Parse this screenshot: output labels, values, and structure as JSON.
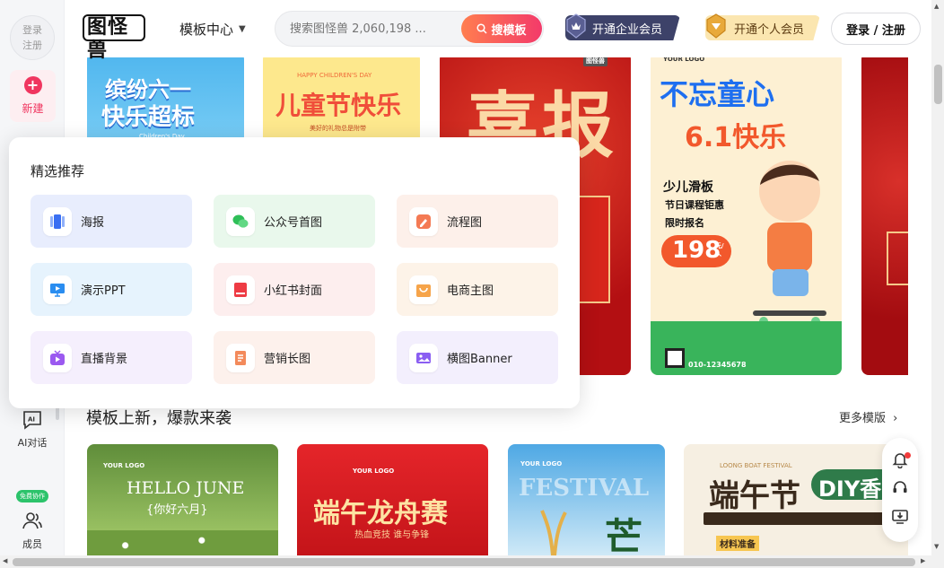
{
  "sidebar": {
    "login_label": "登录\n注册",
    "new_label": "新建",
    "ai_label": "AI对话",
    "free_badge": "免费协作",
    "member_label": "成员"
  },
  "header": {
    "logo": "图怪兽",
    "nav_template": "模板中心",
    "search_placeholder": "搜索图怪兽 2,060,198 ...",
    "search_button": "搜模板",
    "vip_enterprise": "开通企业会员",
    "vip_personal": "开通个人会员",
    "login": "登录 / 注册"
  },
  "popup": {
    "title": "精选推荐",
    "items": [
      {
        "label": "海报",
        "bg": "#e8edfd",
        "icon": "poster-icon"
      },
      {
        "label": "公众号首图",
        "bg": "#e9f8ec",
        "icon": "wechat-icon"
      },
      {
        "label": "流程图",
        "bg": "#fdf0ea",
        "icon": "flowchart-icon"
      },
      {
        "label": "演示PPT",
        "bg": "#e6f3fd",
        "icon": "ppt-icon"
      },
      {
        "label": "小红书封面",
        "bg": "#fdeeee",
        "icon": "xiaohongshu-icon"
      },
      {
        "label": "电商主图",
        "bg": "#fdf3e8",
        "icon": "shop-icon"
      },
      {
        "label": "直播背景",
        "bg": "#f5effd",
        "icon": "live-icon"
      },
      {
        "label": "营销长图",
        "bg": "#fdf1ec",
        "icon": "longimage-icon"
      },
      {
        "label": "横图Banner",
        "bg": "#f3effd",
        "icon": "banner-icon"
      }
    ]
  },
  "top_cards": {
    "card1_title_a": "缤纷六一",
    "card1_title_b": "快乐超标",
    "card1_sub": "Children's Day",
    "card2_top": "HAPPY CHILDREN'S DAY",
    "card2_title": "儿童节快乐",
    "card2_sub": "美好的礼物总是附带",
    "card3_title": "喜报",
    "card3_badge": "图怪兽",
    "card4_logo": "YOUR LOGO",
    "card4_title_a": "不忘童心",
    "card4_title_b": "6.1快乐",
    "card4_line1": "少儿滑板",
    "card4_line2": "节日课程钜惠",
    "card4_line3": "限时报名",
    "card4_price": "198",
    "card4_unit": "元/人",
    "card4_phone": "010-12345678"
  },
  "section": {
    "title": "模板上新，爆款来袭",
    "more": "更多模版"
  },
  "bottom_cards": {
    "b1_logo": "YOUR LOGO",
    "b1_title": "HELLO JUNE",
    "b1_sub": "{你好六月}",
    "b2_logo": "YOUR LOGO",
    "b2_title": "端午龙舟赛",
    "b2_sub": "热血竞技 谁与争锋",
    "b3_logo": "YOUR LOGO",
    "b3_title": "FESTIVAL",
    "b3_char": "芒",
    "b4_top": "LOONG BOAT FESTIVAL",
    "b4_title": "端午节",
    "b4_diy": "DIY香",
    "b4_sub": "材料准备"
  }
}
